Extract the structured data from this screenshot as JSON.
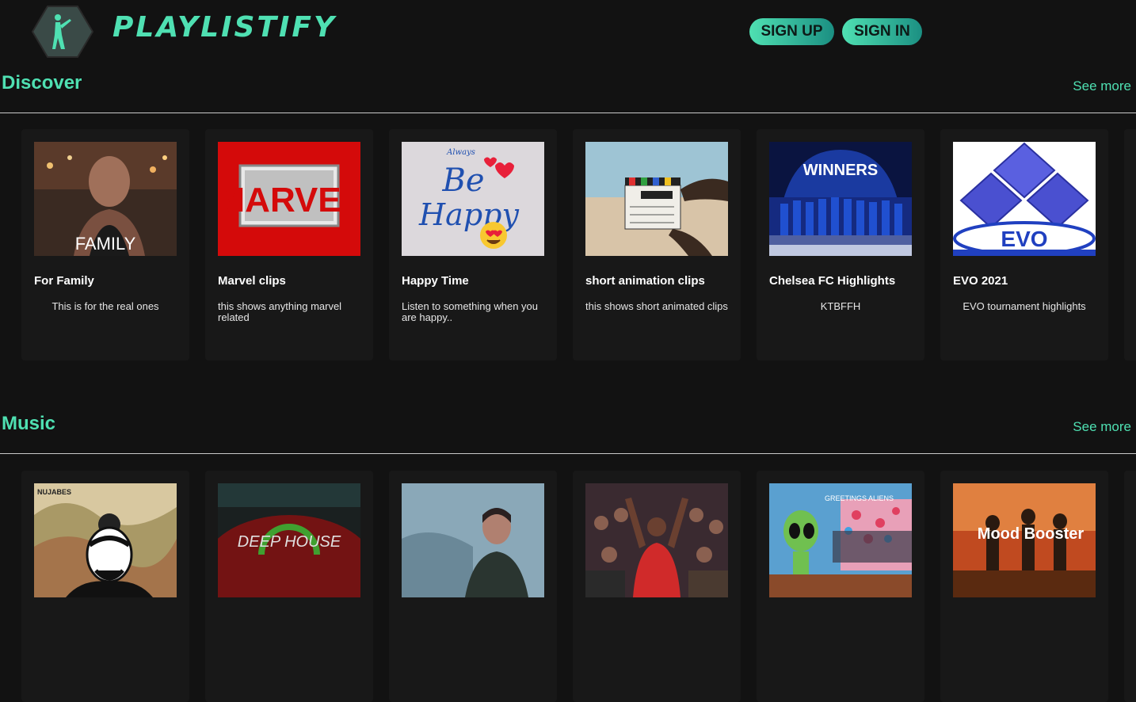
{
  "brand": {
    "name": "PLAYLISTIFY"
  },
  "auth": {
    "signup_label": "SIGN UP",
    "signin_label": "SIGN IN"
  },
  "colors": {
    "accent": "#4fe0b2",
    "background": "#121212",
    "card": "#181818"
  },
  "sections": [
    {
      "title": "Discover",
      "see_more": "See more",
      "cards": [
        {
          "title": "For Family",
          "description": "This is for the real ones",
          "image": "family-poster"
        },
        {
          "title": "Marvel clips",
          "description": "this shows anything marvel related",
          "image": "marvel-logo"
        },
        {
          "title": "Happy Time",
          "description": "Listen to something when you are happy..",
          "image": "be-happy-art"
        },
        {
          "title": "short animation clips",
          "description": "this shows short animated clips",
          "image": "clapperboard-photo"
        },
        {
          "title": "Chelsea FC Highlights",
          "description": "KTBFFH",
          "image": "chelsea-winners-photo"
        },
        {
          "title": "EVO 2021",
          "description": "EVO tournament highlights",
          "image": "evo-logo"
        }
      ]
    },
    {
      "title": "Music",
      "see_more": "See more",
      "cards": [
        {
          "image": "nujabes-album",
          "label": "NUJABES"
        },
        {
          "image": "deep-house-cover",
          "label": "DEEP HOUSE"
        },
        {
          "image": "man-portrait-photo"
        },
        {
          "image": "concert-crowd-photo"
        },
        {
          "image": "alien-mural-photo",
          "label": "GREETINGS ALIENS"
        },
        {
          "image": "mood-booster-cover",
          "label": "Mood Booster"
        }
      ]
    }
  ]
}
